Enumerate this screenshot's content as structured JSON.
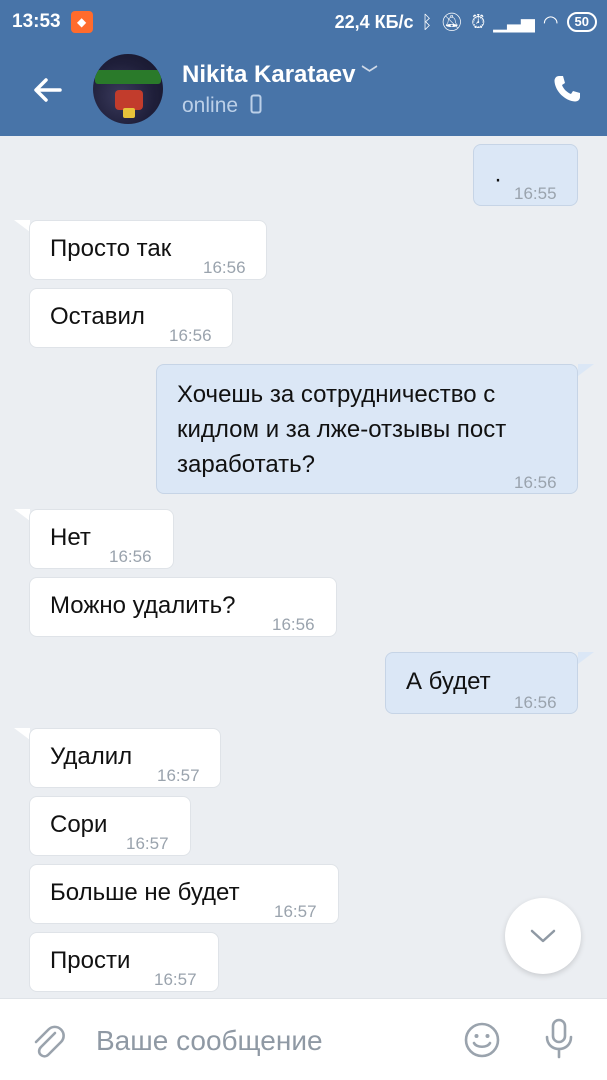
{
  "status_bar": {
    "time": "13:53",
    "net_speed": "22,4 КБ/с",
    "battery": "50"
  },
  "header": {
    "name": "Nikita Karataev",
    "status": "online"
  },
  "messages": [
    {
      "text": "·",
      "time": "16:55"
    },
    {
      "text": "Просто так",
      "time": "16:56"
    },
    {
      "text": "Оставил",
      "time": "16:56"
    },
    {
      "line1": "Хочешь за сотрудничество с",
      "line2": "кидлом и за лже-отзывы пост",
      "line3": "заработать?",
      "time": "16:56"
    },
    {
      "text": "Нет",
      "time": "16:56"
    },
    {
      "text": "Можно удалить?",
      "time": "16:56"
    },
    {
      "text": "А будет",
      "time": "16:56"
    },
    {
      "text": "Удалил",
      "time": "16:57"
    },
    {
      "text": "Сори",
      "time": "16:57"
    },
    {
      "text": "Больше не будет",
      "time": "16:57"
    },
    {
      "text": "Прости",
      "time": "16:57"
    }
  ],
  "composer": {
    "placeholder": "Ваше сообщение"
  },
  "colors": {
    "header_bg": "#4874a8",
    "chat_bg": "#ebeef2",
    "incoming_bubble": "#ffffff",
    "outgoing_bubble": "#dbe7f6",
    "icon_gray": "#9aa3ad"
  }
}
